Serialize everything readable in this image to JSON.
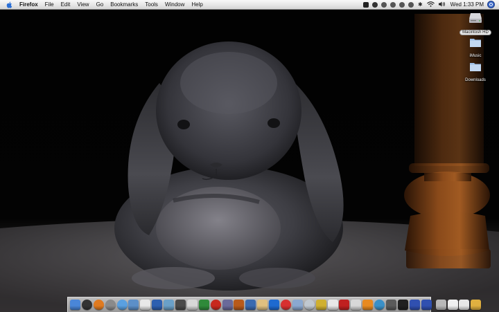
{
  "menubar": {
    "app_name": "Firefox",
    "menus": [
      "File",
      "Edit",
      "View",
      "Go",
      "Bookmarks",
      "Tools",
      "Window",
      "Help"
    ],
    "clock": "Wed 1:33 PM",
    "status_icons": [
      "script-icon",
      "moon-icon",
      "rewind-icon",
      "play-icon",
      "forward-icon",
      "eject-icon",
      "bluetooth-icon",
      "wifi-icon",
      "volume-icon"
    ]
  },
  "desktop": {
    "icons": [
      {
        "label": "Macintosh HD",
        "kind": "hard-drive-icon"
      },
      {
        "label": "iMusic",
        "kind": "folder-icon"
      },
      {
        "label": "Downloads",
        "kind": "folder-icon"
      }
    ]
  },
  "dock": {
    "apps": [
      {
        "name": "finder-icon",
        "color": "#4a86d8"
      },
      {
        "name": "dashboard-icon",
        "color": "#333333"
      },
      {
        "name": "firefox-icon",
        "color": "#e07a1f"
      },
      {
        "name": "system-preferences-icon",
        "color": "#8a8a8a"
      },
      {
        "name": "itunes-icon",
        "color": "#5aa0e0"
      },
      {
        "name": "iphoto-icon",
        "color": "#5c8fc8"
      },
      {
        "name": "textedit-icon",
        "color": "#e8e8e8"
      },
      {
        "name": "word-icon",
        "color": "#2d5fb0"
      },
      {
        "name": "preview-icon",
        "color": "#6aa0c8"
      },
      {
        "name": "grab-icon",
        "color": "#4a4a4a"
      },
      {
        "name": "ical-icon",
        "color": "#d8d8d8"
      },
      {
        "name": "activity-monitor-icon",
        "color": "#2f8a3a"
      },
      {
        "name": "flash-icon",
        "color": "#c8281e"
      },
      {
        "name": "photoshop-icon",
        "color": "#6a6a9a"
      },
      {
        "name": "imovie-icon",
        "color": "#b85a1a"
      },
      {
        "name": "final-cut-icon",
        "color": "#3a6ab0"
      },
      {
        "name": "idvd-icon",
        "color": "#e0c080"
      },
      {
        "name": "garageband-icon",
        "color": "#1e6ad0"
      },
      {
        "name": "keynote-icon",
        "color": "#d83030"
      },
      {
        "name": "pages-icon",
        "color": "#8aa8d0"
      },
      {
        "name": "safari-icon",
        "color": "#c0c8d0"
      },
      {
        "name": "mail-icon",
        "color": "#d0b030"
      },
      {
        "name": "calendar-icon",
        "color": "#e8e8e8"
      },
      {
        "name": "skype-icon",
        "color": "#c02020"
      },
      {
        "name": "ipod-icon",
        "color": "#d8d8d8"
      },
      {
        "name": "vlc-icon",
        "color": "#e88a20"
      },
      {
        "name": "network-icon",
        "color": "#3a90c8"
      },
      {
        "name": "calculator-icon",
        "color": "#5a5a5a"
      },
      {
        "name": "yahoo-widget-icon",
        "color": "#202020"
      },
      {
        "name": "airplane-icon",
        "color": "#3050b0"
      },
      {
        "name": "uploader-icon",
        "color": "#3050b0"
      }
    ],
    "docs": [
      {
        "name": "web-docs-icon",
        "color": "#b8b8b8"
      },
      {
        "name": "minimized-window-icon",
        "color": "#f0f0f0"
      },
      {
        "name": "minimized-window-icon-2",
        "color": "#e8e8e8"
      },
      {
        "name": "trash-icon",
        "color": "#e0b040"
      }
    ]
  }
}
